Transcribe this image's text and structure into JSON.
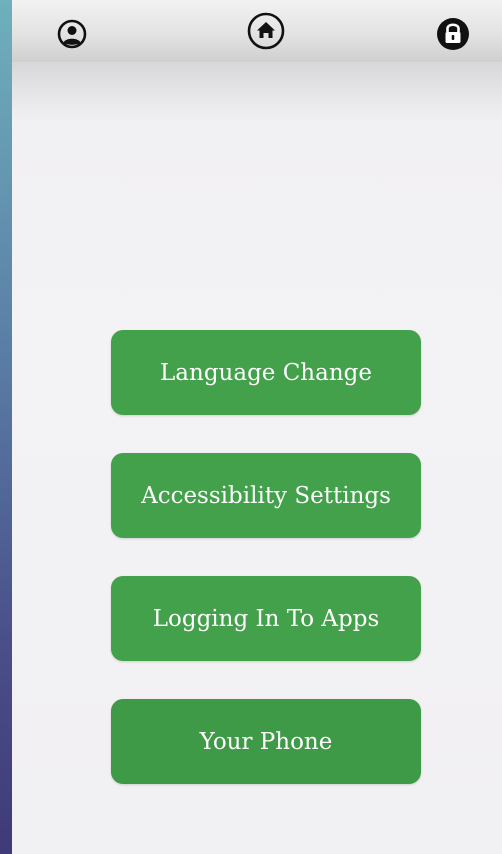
{
  "header": {
    "icons": {
      "profile": "profile-icon",
      "home": "home-icon",
      "lock": "lock-icon"
    }
  },
  "menu": {
    "items": [
      {
        "label": "Language Change"
      },
      {
        "label": "Accessibility Settings"
      },
      {
        "label": "Logging In To Apps"
      },
      {
        "label": "Your Phone"
      }
    ]
  },
  "colors": {
    "button_green": "#43a04b",
    "button_text": "#ffffff",
    "icon_black": "#111111"
  }
}
